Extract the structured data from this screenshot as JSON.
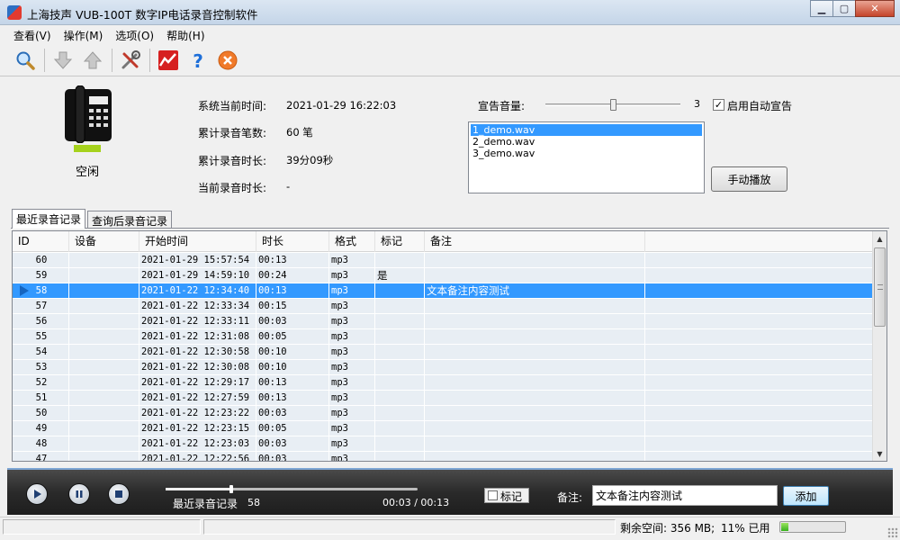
{
  "window": {
    "title": "上海技声 VUB-100T 数字IP电话录音控制软件",
    "minimize_glyph": "▁",
    "maximize_glyph": "▢",
    "close_glyph": "✕"
  },
  "menu": {
    "items": [
      {
        "label": "查看(V)"
      },
      {
        "label": "操作(M)"
      },
      {
        "label": "选项(O)"
      },
      {
        "label": "帮助(H)"
      }
    ]
  },
  "toolbar": {
    "icons": [
      "search-icon",
      "download-arrow-icon",
      "upload-arrow-icon",
      "tools-icon",
      "chart-icon",
      "help-icon",
      "close-circle-icon"
    ]
  },
  "status_panel": {
    "phone_state": "空闲",
    "phone_state_color": "#a6d21d",
    "system_time_label": "系统当前时间:",
    "system_time_value": "2021-01-29 16:22:03",
    "total_count_label": "累计录音笔数:",
    "total_count_value": "60 笔",
    "total_duration_label": "累计录音时长:",
    "total_duration_value": "39分09秒",
    "current_duration_label": "当前录音时长:",
    "current_duration_value": "-"
  },
  "announce": {
    "volume_label": "宣告音量:",
    "volume_value": "3",
    "auto_announce_label": "启用自动宣告",
    "auto_announce_checked": true,
    "files": [
      "1_demo.wav",
      "2_demo.wav",
      "3_demo.wav"
    ],
    "selected_file_index": 0,
    "manual_play_label": "手动播放"
  },
  "tabs": [
    {
      "label": "最近录音记录",
      "active": true
    },
    {
      "label": "查询后录音记录",
      "active": false
    }
  ],
  "grid": {
    "columns": [
      "ID",
      "设备",
      "开始时间",
      "时长",
      "格式",
      "标记",
      "备注"
    ],
    "rows": [
      {
        "id": "60",
        "device": "",
        "start": "2021-01-29 15:57:54",
        "duration": "00:13",
        "format": "mp3",
        "mark": "",
        "note": ""
      },
      {
        "id": "59",
        "device": "",
        "start": "2021-01-29 14:59:10",
        "duration": "00:24",
        "format": "mp3",
        "mark": "是",
        "note": ""
      },
      {
        "id": "58",
        "device": "",
        "start": "2021-01-22 12:34:40",
        "duration": "00:13",
        "format": "mp3",
        "mark": "",
        "note": "文本备注内容测试"
      },
      {
        "id": "57",
        "device": "",
        "start": "2021-01-22 12:33:34",
        "duration": "00:15",
        "format": "mp3",
        "mark": "",
        "note": ""
      },
      {
        "id": "56",
        "device": "",
        "start": "2021-01-22 12:33:11",
        "duration": "00:03",
        "format": "mp3",
        "mark": "",
        "note": ""
      },
      {
        "id": "55",
        "device": "",
        "start": "2021-01-22 12:31:08",
        "duration": "00:05",
        "format": "mp3",
        "mark": "",
        "note": ""
      },
      {
        "id": "54",
        "device": "",
        "start": "2021-01-22 12:30:58",
        "duration": "00:10",
        "format": "mp3",
        "mark": "",
        "note": ""
      },
      {
        "id": "53",
        "device": "",
        "start": "2021-01-22 12:30:08",
        "duration": "00:10",
        "format": "mp3",
        "mark": "",
        "note": ""
      },
      {
        "id": "52",
        "device": "",
        "start": "2021-01-22 12:29:17",
        "duration": "00:13",
        "format": "mp3",
        "mark": "",
        "note": ""
      },
      {
        "id": "51",
        "device": "",
        "start": "2021-01-22 12:27:59",
        "duration": "00:13",
        "format": "mp3",
        "mark": "",
        "note": ""
      },
      {
        "id": "50",
        "device": "",
        "start": "2021-01-22 12:23:22",
        "duration": "00:03",
        "format": "mp3",
        "mark": "",
        "note": ""
      },
      {
        "id": "49",
        "device": "",
        "start": "2021-01-22 12:23:15",
        "duration": "00:05",
        "format": "mp3",
        "mark": "",
        "note": ""
      },
      {
        "id": "48",
        "device": "",
        "start": "2021-01-22 12:23:03",
        "duration": "00:03",
        "format": "mp3",
        "mark": "",
        "note": ""
      },
      {
        "id": "47",
        "device": "",
        "start": "2021-01-22 12:22:56",
        "duration": "00:03",
        "format": "mp3",
        "mark": "",
        "note": ""
      }
    ],
    "selected_row_index": 2,
    "selected_color": "#3399ff"
  },
  "player": {
    "source_label": "最近录音记录",
    "record_id": "58",
    "time_display": "00:03 / 00:13",
    "progress_fraction": 0.26,
    "mark_label": "标记",
    "note_label": "备注:",
    "note_value": "文本备注内容测试",
    "add_label": "添加"
  },
  "statusbar": {
    "free_space_text": "剩余空间: 356 MB;",
    "used_text": "11% 已用",
    "used_fraction": 0.11
  }
}
